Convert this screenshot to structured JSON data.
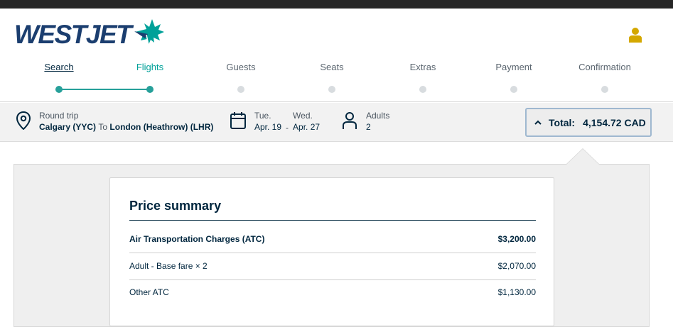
{
  "brand": {
    "name": "WESTJET",
    "accent": "#00a199",
    "navy": "#00263e"
  },
  "header": {
    "user_icon": "user-icon"
  },
  "steps": [
    {
      "label": "Search",
      "state": "done"
    },
    {
      "label": "Flights",
      "state": "current"
    },
    {
      "label": "Guests",
      "state": "upcoming"
    },
    {
      "label": "Seats",
      "state": "upcoming"
    },
    {
      "label": "Extras",
      "state": "upcoming"
    },
    {
      "label": "Payment",
      "state": "upcoming"
    },
    {
      "label": "Confirmation",
      "state": "upcoming"
    }
  ],
  "trip": {
    "type": "Round trip",
    "origin": "Calgary (YYC)",
    "to_word": "To",
    "destination": "London (Heathrow) (LHR)",
    "depart_day": "Tue.",
    "depart_date": "Apr. 19",
    "return_day": "Wed.",
    "return_date": "Apr. 27",
    "date_separator": "-",
    "passenger_type": "Adults",
    "passenger_count": "2"
  },
  "total": {
    "label": "Total:",
    "value": "4,154.72 CAD"
  },
  "price_summary": {
    "title": "Price summary",
    "rows": [
      {
        "label": "Air Transportation Charges (ATC)",
        "amount": "$3,200.00",
        "bold": true
      },
      {
        "label": "Adult - Base fare × 2",
        "amount": "$2,070.00",
        "bold": false
      },
      {
        "label": "Other ATC",
        "amount": "$1,130.00",
        "bold": false
      }
    ]
  }
}
